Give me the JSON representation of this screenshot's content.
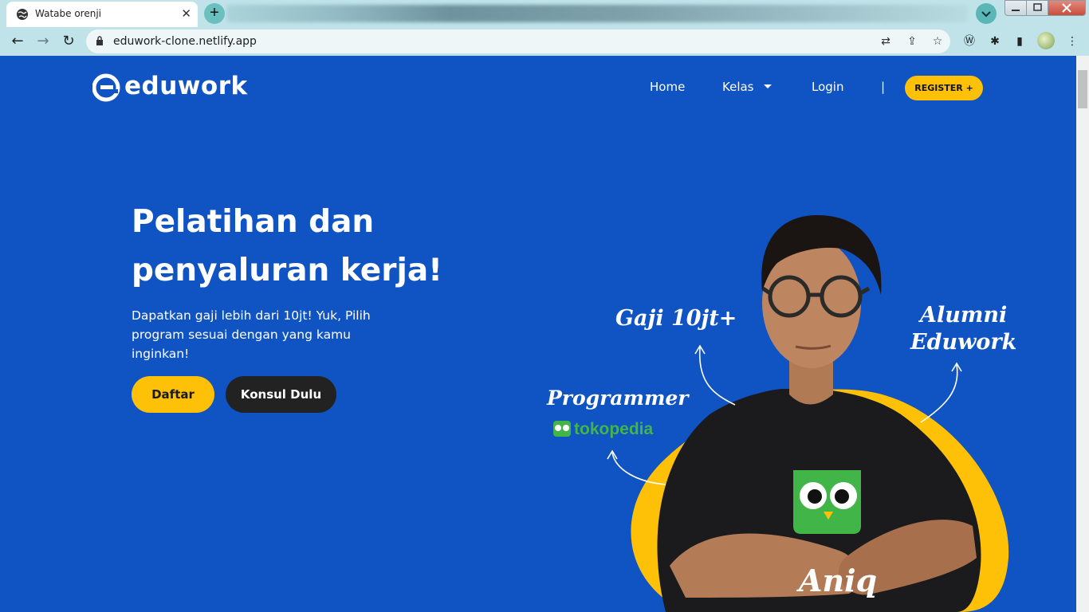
{
  "browser": {
    "tab_title": "Watabe orenji",
    "url": "eduwork-clone.netlify.app"
  },
  "site": {
    "logo_text": "eduwork",
    "nav": {
      "home": "Home",
      "kelas": "Kelas",
      "login": "Login",
      "divider": "|",
      "register": "REGISTER +"
    }
  },
  "hero": {
    "title_line1": "Pelatihan dan",
    "title_line2": "penyaluran kerja!",
    "subtitle": "Dapatkan gaji lebih dari 10jt! Yuk, Pilih program sesuai dengan yang kamu inginkan!",
    "cta_primary": "Daftar",
    "cta_secondary": "Konsul Dulu"
  },
  "illustration": {
    "label_salary": "Gaji 10jt+",
    "label_alumni_1": "Alumni",
    "label_alumni_2": "Eduwork",
    "label_programmer": "Programmer",
    "label_company": "tokopedia",
    "label_name": "Aniq"
  },
  "colors": {
    "brand_blue": "#1053c2",
    "accent_yellow": "#ffc107",
    "dark_button": "#222222",
    "tokopedia_green": "#42b549"
  }
}
